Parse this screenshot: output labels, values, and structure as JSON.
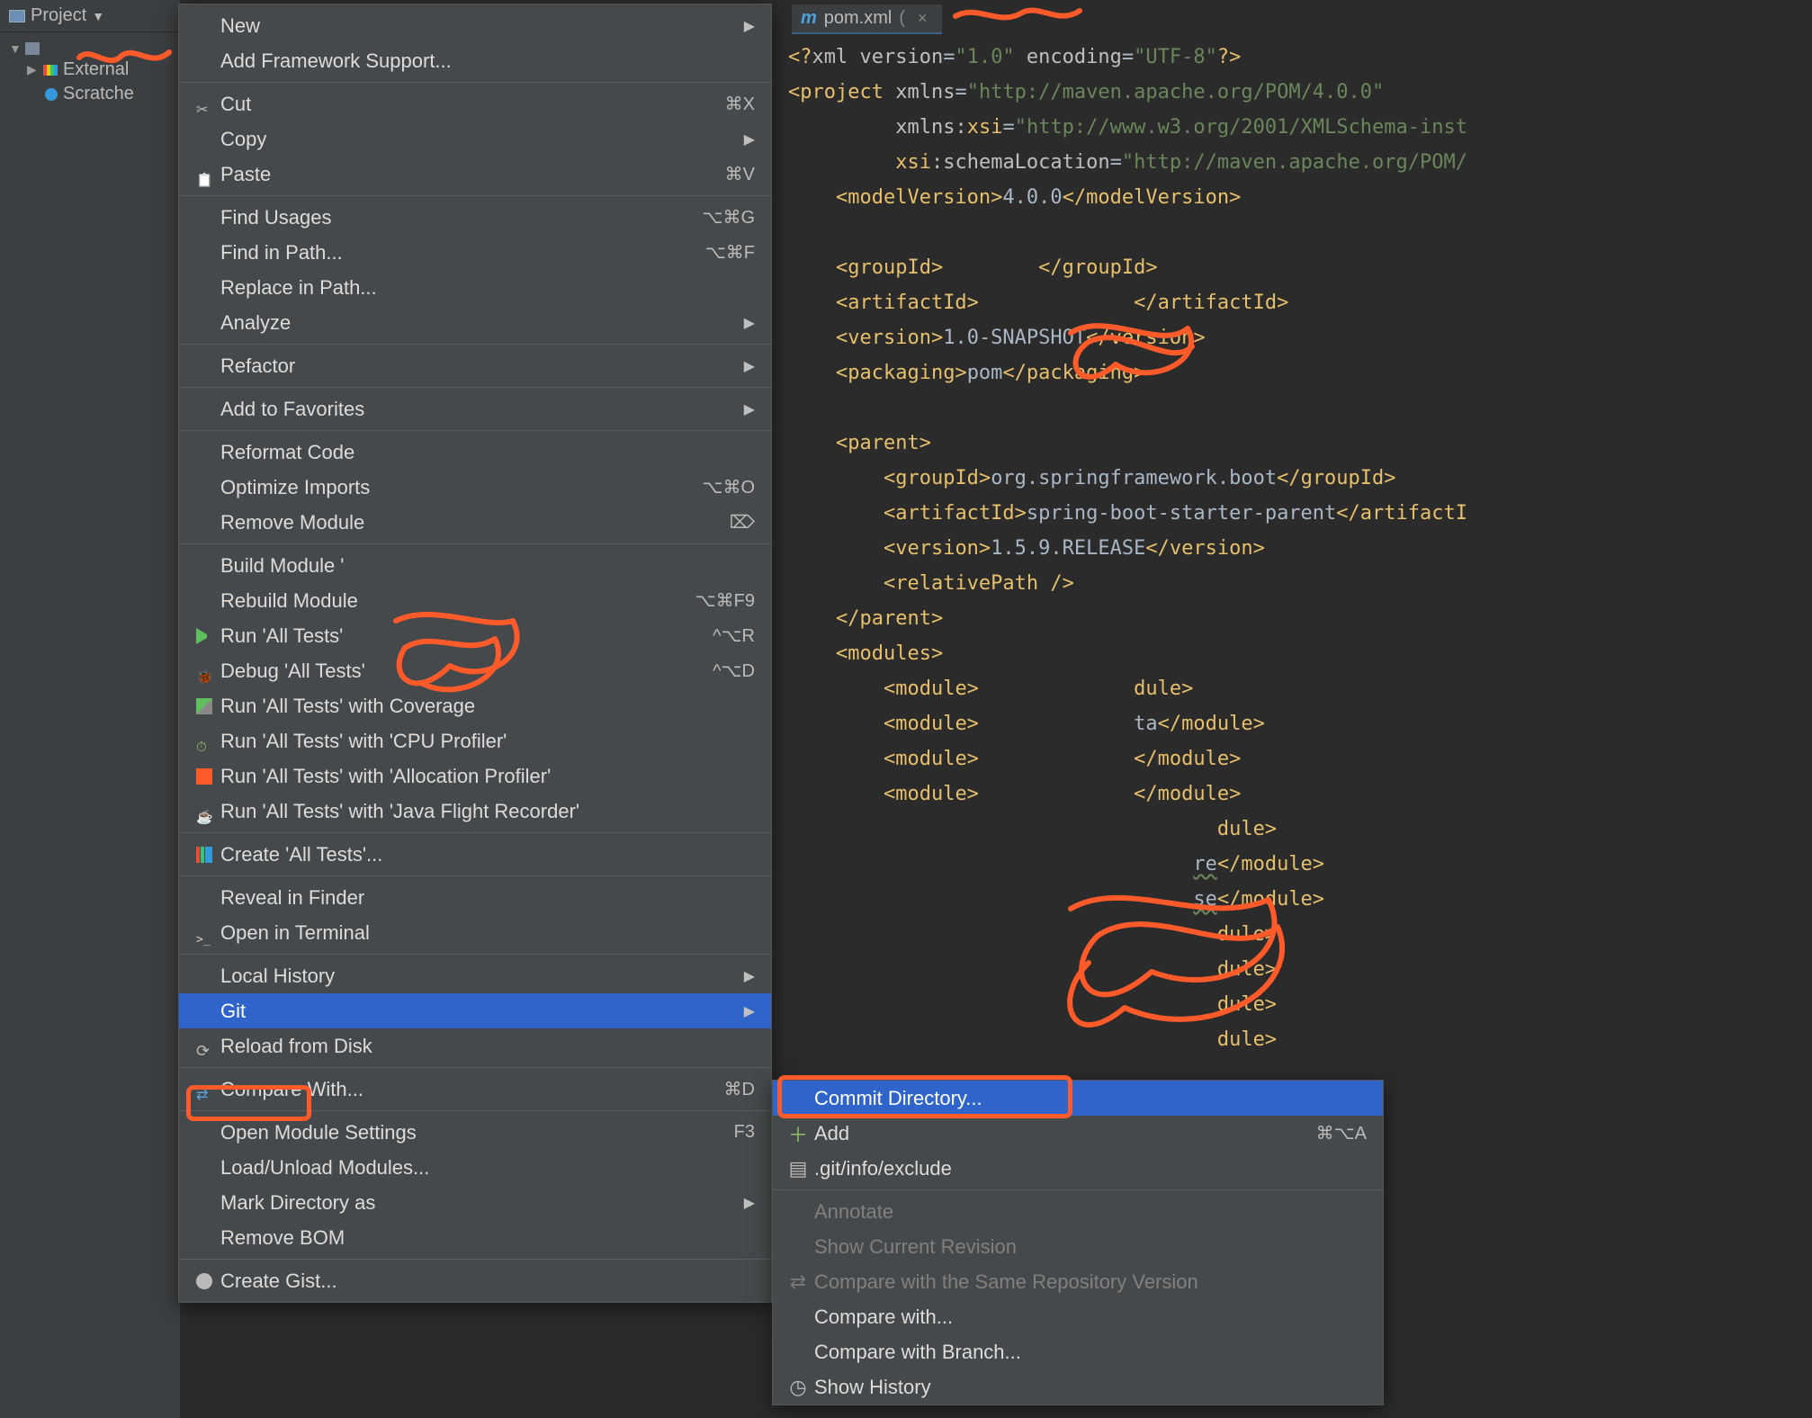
{
  "sidebar": {
    "title": "Project",
    "items": {
      "external": "External",
      "scratches": "Scratche"
    }
  },
  "tab": {
    "filename": "pom.xml",
    "paren_open": "("
  },
  "editor": {
    "l1_a": "<?",
    "l1_b": "xml version",
    "l1_c": "=",
    "l1_d": "\"1.0\"",
    "l1_e": " encoding",
    "l1_f": "=",
    "l1_g": "\"UTF-8\"",
    "l1_h": "?>",
    "l2_a": "<project",
    "l2_b": " xmlns",
    "l2_c": "=",
    "l2_d": "\"http://maven.apache.org/POM/4.0.0\"",
    "l3_a": "xmlns:",
    "l3_b": "xsi",
    "l3_c": "=",
    "l3_d": "\"http://www.w3.org/2001/XMLSchema-inst",
    "l4_a": "xsi",
    "l4_b": ":schemaLocation",
    "l4_c": "=",
    "l4_d": "\"http://maven.apache.org/POM/",
    "l5_a": "<modelVersion>",
    "l5_b": "4.0.0",
    "l5_c": "</modelVersion>",
    "l6_a": "<groupId>",
    "l6_b": "</groupId>",
    "l7_a": "<artifactId>",
    "l7_b": "</artifactId>",
    "l8_a": "<version>",
    "l8_b": "1.0-SNAPSHOT",
    "l8_c": "</version>",
    "l9_a": "<packaging>",
    "l9_b": "pom",
    "l9_c": "</packaging>",
    "l10_a": "<parent>",
    "l11_a": "<groupId>",
    "l11_b": "org.springframework.boot",
    "l11_c": "</groupId>",
    "l12_a": "<artifactId>",
    "l12_b": "spring-boot-starter-parent",
    "l12_c": "</artifactI",
    "l13_a": "<version>",
    "l13_b": "1.5.9.RELEASE",
    "l13_c": "</version>",
    "l14_a": "<relativePath />",
    "l15_a": "</parent>",
    "l16_a": "<modules>",
    "m_open": "<module>",
    "m_close": "</module>",
    "m5suffix": "re",
    "m6suffix": "se",
    "m_tail": "dule>",
    "m_ta": "ta"
  },
  "menu": {
    "new": "New",
    "addFramework": "Add Framework Support...",
    "cut": "Cut",
    "cut_sc": "⌘X",
    "copy": "Copy",
    "paste": "Paste",
    "paste_sc": "⌘V",
    "findUsages": "Find Usages",
    "findUsages_sc": "⌥⌘G",
    "findInPath": "Find in Path...",
    "findInPath_sc": "⌥⌘F",
    "replaceInPath": "Replace in Path...",
    "analyze": "Analyze",
    "refactor": "Refactor",
    "addFav": "Add to Favorites",
    "reformat": "Reformat Code",
    "optimizeImports": "Optimize Imports",
    "optimizeImports_sc": "⌥⌘O",
    "removeModule": "Remove Module",
    "removeModule_sc": "⌦",
    "buildModule": "Build Module '",
    "rebuildModule": "Rebuild Module",
    "rebuildModule_sc": "⌥⌘F9",
    "runAll": "Run 'All Tests'",
    "runAll_sc": "^⌥R",
    "debugAll": "Debug 'All Tests'",
    "debugAll_sc": "^⌥D",
    "runCov": "Run 'All Tests' with Coverage",
    "runCpu": "Run 'All Tests' with 'CPU Profiler'",
    "runAlloc": "Run 'All Tests' with 'Allocation Profiler'",
    "runJfr": "Run 'All Tests' with 'Java Flight Recorder'",
    "createAll": "Create 'All Tests'...",
    "revealFinder": "Reveal in Finder",
    "openTerminal": "Open in Terminal",
    "localHistory": "Local History",
    "git": "Git",
    "reloadDisk": "Reload from Disk",
    "compareWith": "Compare With...",
    "compareWith_sc": "⌘D",
    "openModuleSettings": "Open Module Settings",
    "openModuleSettings_sc": "F3",
    "loadUnload": "Load/Unload Modules...",
    "markDirAs": "Mark Directory as",
    "removeBom": "Remove BOM",
    "createGist": "Create Gist..."
  },
  "submenu": {
    "commitDir": "Commit Directory...",
    "add": "Add",
    "add_sc": "⌘⌥A",
    "gitinfo": ".git/info/exclude",
    "annotate": "Annotate",
    "showRev": "Show Current Revision",
    "compareSameRepo": "Compare with the Same Repository Version",
    "compareWith": "Compare with...",
    "compareBranch": "Compare with Branch...",
    "showHistory": "Show History"
  }
}
